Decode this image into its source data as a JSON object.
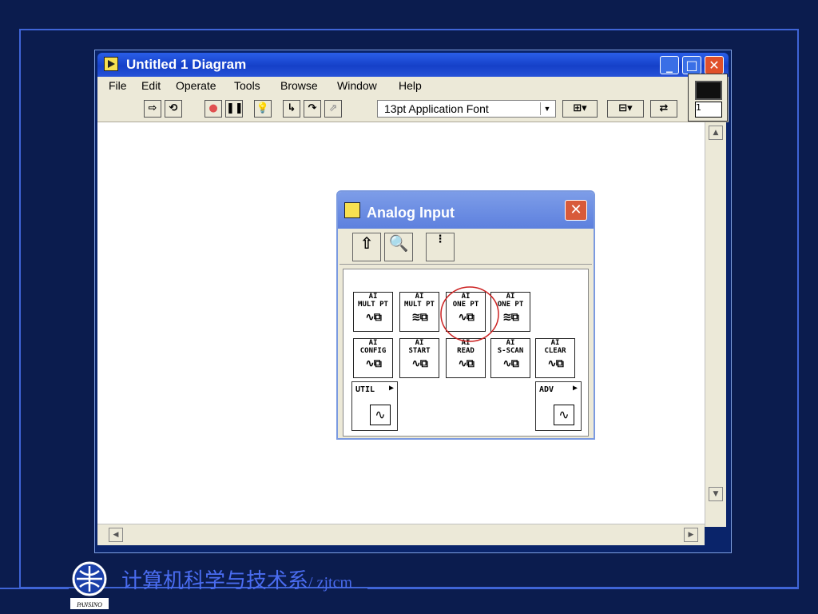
{
  "window": {
    "title": "Untitled 1 Diagram",
    "menu": [
      "File",
      "Edit",
      "Operate",
      "Tools",
      "Browse",
      "Window",
      "Help"
    ],
    "toolbar": {
      "font_select": "13pt Application Font"
    },
    "panel_icon_number": "1"
  },
  "palette": {
    "title": "Analog Input",
    "vis": [
      {
        "line1": "AI",
        "line2": "MULT PT"
      },
      {
        "line1": "AI",
        "line2": "MULT PT"
      },
      {
        "line1": "AI",
        "line2": "ONE PT"
      },
      {
        "line1": "AI",
        "line2": "ONE PT"
      },
      {
        "line1": "AI",
        "line2": "CONFIG"
      },
      {
        "line1": "AI",
        "line2": "START"
      },
      {
        "line1": "AI",
        "line2": "READ"
      },
      {
        "line1": "AI",
        "line2": "S-SCAN"
      },
      {
        "line1": "AI",
        "line2": "CLEAR"
      }
    ],
    "subpalettes": [
      {
        "label": "UTIL"
      },
      {
        "label": "ADV"
      }
    ]
  },
  "footer": {
    "chinese": "计算机科学与技术系",
    "latin": "/ zjtcm",
    "logo_text": "PANSINO"
  },
  "colors": {
    "background": "#0b1c4e",
    "frame": "#3f64d6",
    "footer_text": "#4a6cf0",
    "highlight_circle": "#cc2222"
  }
}
